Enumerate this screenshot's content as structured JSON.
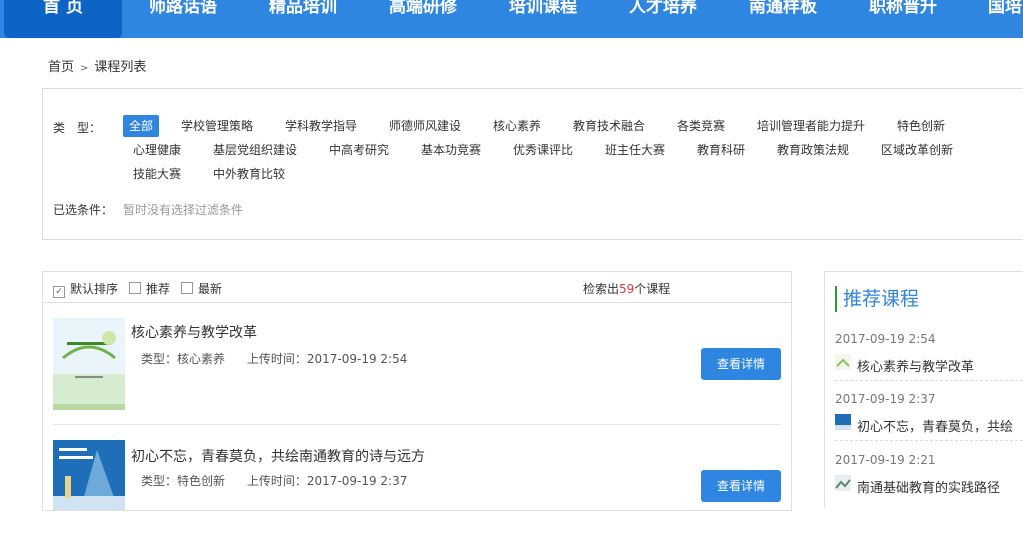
{
  "nav": {
    "items": [
      {
        "label": "首 页",
        "active": true
      },
      {
        "label": "师路话语"
      },
      {
        "label": "精品培训"
      },
      {
        "label": "高端研修"
      },
      {
        "label": "培训课程"
      },
      {
        "label": "人才培养"
      },
      {
        "label": "南通样板"
      },
      {
        "label": "职称晋升"
      },
      {
        "label": "国培"
      }
    ]
  },
  "breadcrumb": {
    "home": "首页",
    "sep": ">",
    "current": "课程列表"
  },
  "filter": {
    "type_label": "类　型：",
    "tags": [
      "全部",
      "学校管理策略",
      "学科教学指导",
      "师德师风建设",
      "核心素养",
      "教育技术融合",
      "各类竞赛",
      "培训管理者能力提升",
      "特色创新",
      "心理健康",
      "基层党组织建设",
      "中高考研究",
      "基本功竞赛",
      "优秀课评比",
      "班主任大赛",
      "教育科研",
      "教育政策法规",
      "区域改革创新",
      "技能大赛",
      "中外教育比较"
    ],
    "selected_label": "已选条件：",
    "selected_none": "暂时没有选择过滤条件"
  },
  "list": {
    "sort": [
      "默认排序",
      "推荐",
      "最新"
    ],
    "count_prefix": "检索出",
    "count": "59",
    "count_suffix": "个课程",
    "courses": [
      {
        "title": "核心素养与教学改革",
        "type": "类型：核心素养",
        "time": "上传时间：2017-09-19 2:54",
        "button": "查看详情"
      },
      {
        "title": "初心不忘，青春莫负，共绘南通教育的诗与远方",
        "type": "类型：特色创新",
        "time": "上传时间：2017-09-19 2:37",
        "button": "查看详情"
      }
    ]
  },
  "recommend": {
    "title": "推荐课程",
    "items": [
      {
        "date": "2017-09-19 2:54",
        "name": "核心素养与教学改革"
      },
      {
        "date": "2017-09-19 2:37",
        "name": "初心不忘，青春莫负，共绘"
      },
      {
        "date": "2017-09-19 2:21",
        "name": "南通基础教育的实践路径"
      }
    ]
  },
  "colors": {
    "brand": "#2f86e0",
    "nav_active": "#0e63c7",
    "count": "#e4393c",
    "accent_bar": "#2a9c2e"
  }
}
